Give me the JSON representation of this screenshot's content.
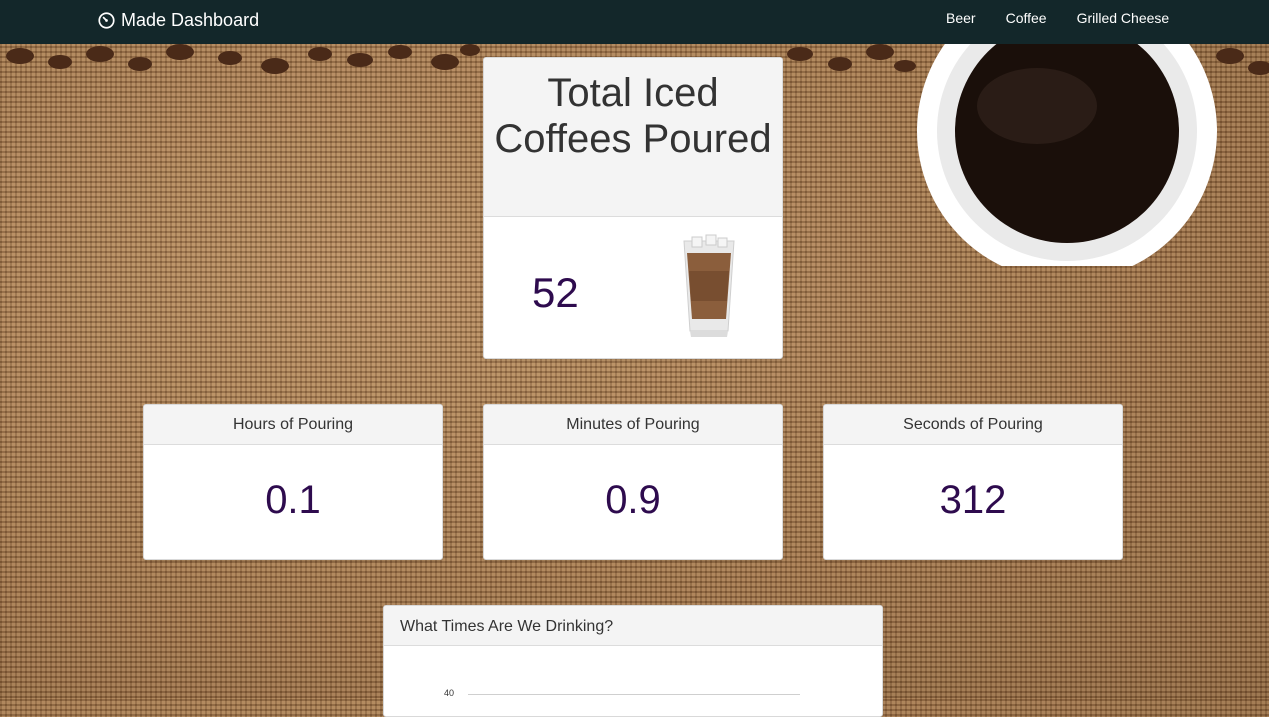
{
  "navbar": {
    "brand_icon": "dashboard-gauge-icon",
    "brand": "Made Dashboard",
    "links": [
      "Beer",
      "Coffee",
      "Grilled Cheese"
    ]
  },
  "hero": {
    "title": "Total Iced Coffees Poured",
    "value": "52",
    "image": "iced-coffee-glass-icon"
  },
  "stats": [
    {
      "label": "Hours of Pouring",
      "value": "0.1"
    },
    {
      "label": "Minutes of Pouring",
      "value": "0.9"
    },
    {
      "label": "Seconds of Pouring",
      "value": "312"
    }
  ],
  "chart": {
    "title": "What Times Are We Drinking?",
    "visible_tick": "40"
  },
  "colors": {
    "navbar": "#13272a",
    "value_text": "#2e0b4e",
    "panel_heading": "#f4f4f4"
  }
}
